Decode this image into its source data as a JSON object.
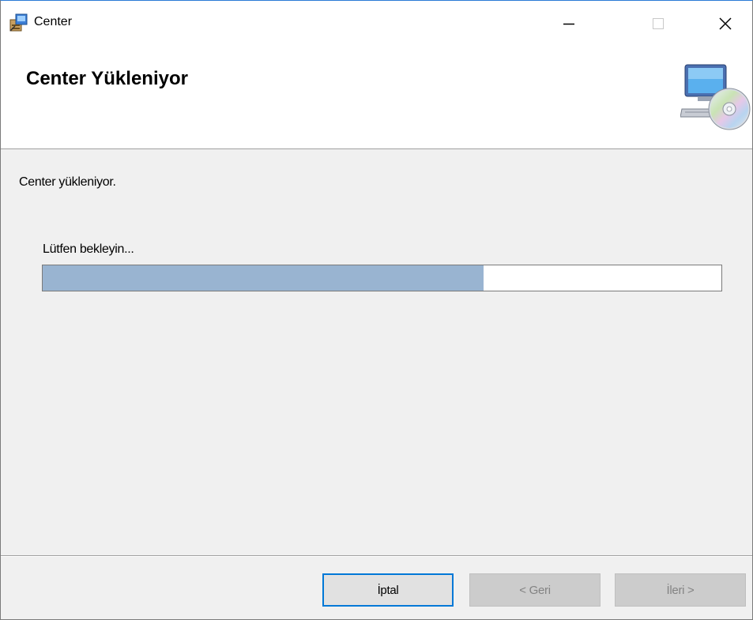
{
  "window": {
    "title": "Center",
    "app_icon": "installer-package-icon",
    "controls": {
      "minimize_icon": "minimize-icon",
      "maximize_icon": "maximize-icon",
      "close_icon": "close-icon"
    },
    "accent_color": "#0078d7"
  },
  "banner": {
    "title": "Center Yükleniyor",
    "image": "computer-cd-icon"
  },
  "body": {
    "description": "Center yükleniyor.",
    "wait_label": "Lütfen bekleyin...",
    "progress_percent": 65,
    "progress_color": "#99b4d1"
  },
  "footer": {
    "cancel_label": "İptal",
    "back_label": "< Geri",
    "next_label": "İleri >"
  }
}
